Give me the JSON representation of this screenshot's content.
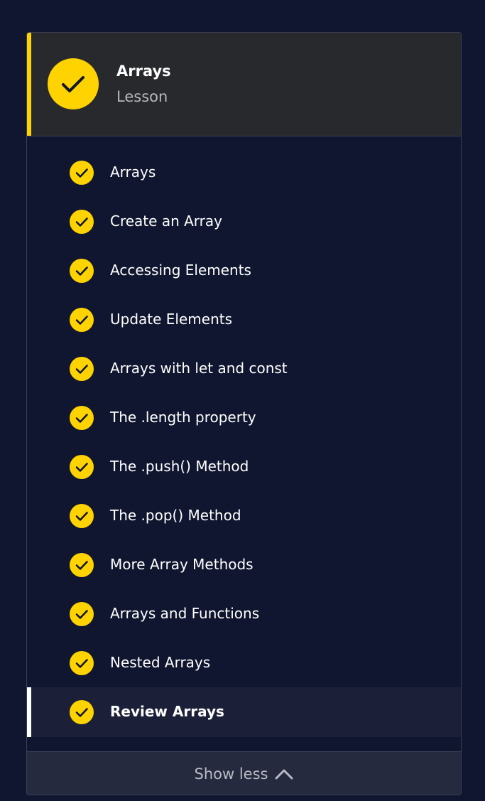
{
  "lesson": {
    "title": "Arrays",
    "type": "Lesson",
    "status_icon": "check-icon"
  },
  "items": [
    {
      "label": "Arrays",
      "completed": true
    },
    {
      "label": "Create an Array",
      "completed": true
    },
    {
      "label": "Accessing Elements",
      "completed": true
    },
    {
      "label": "Update Elements",
      "completed": true
    },
    {
      "label": "Arrays with let and const",
      "completed": true
    },
    {
      "label": "The .length property",
      "completed": true
    },
    {
      "label": "The .push() Method",
      "completed": true
    },
    {
      "label": "The .pop() Method",
      "completed": true
    },
    {
      "label": "More Array Methods",
      "completed": true
    },
    {
      "label": "Arrays and Functions",
      "completed": true
    },
    {
      "label": "Nested Arrays",
      "completed": true
    },
    {
      "label": "Review Arrays",
      "completed": true,
      "active": true
    }
  ],
  "footer": {
    "show_less_label": "Show less",
    "toggle_icon": "chevron-up-icon"
  },
  "colors": {
    "background": "#10162f",
    "accent": "#ffd300",
    "header_bg": "#28292d",
    "active_row_bg": "#1b2038"
  }
}
